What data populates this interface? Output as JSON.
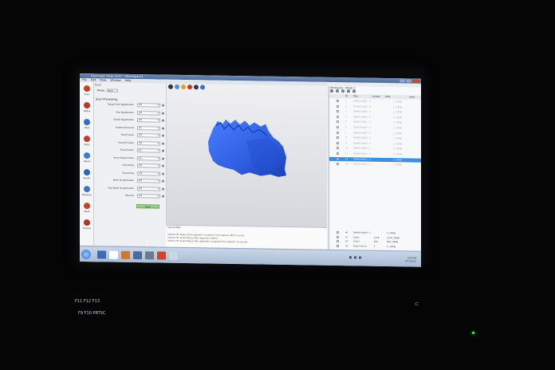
{
  "window": {
    "title": "Geomagic Wrap 2013 - [Workspace]"
  },
  "menu": [
    "File",
    "Edit",
    "View",
    "Window",
    "Help"
  ],
  "toolbar_left": [
    {
      "label": "Scan",
      "icon": "scan-icon",
      "color": "#c8401f"
    },
    {
      "label": "Tables",
      "icon": "tables-icon",
      "color": "#b33a2a"
    },
    {
      "label": "Tools",
      "icon": "tools-icon",
      "color": "#2e6ec8"
    },
    {
      "label": "Align",
      "icon": "align-icon",
      "color": "#c23c2c"
    },
    {
      "label": "Object",
      "icon": "object-icon",
      "color": "#3b7bd3"
    },
    {
      "label": "Repair",
      "icon": "repair-icon",
      "color": "#2c64ba"
    },
    {
      "label": "Measure",
      "icon": "measure-icon",
      "color": "#4073c7"
    },
    {
      "label": "Mesh",
      "icon": "mesh-icon",
      "color": "#c5432b"
    },
    {
      "label": "Feature",
      "icon": "feature-icon",
      "color": "#b13424"
    }
  ],
  "panel": {
    "title": "Scan",
    "mode_label": "Mode:",
    "mode_value": "Auto",
    "section": "Scan Processing",
    "rows": [
      {
        "label": "Rough Scan Registration",
        "value": "Off"
      },
      {
        "label": "Fine Registration",
        "value": "Off"
      },
      {
        "label": "Global Registration",
        "value": "Off"
      },
      {
        "label": "Outliers Removal",
        "value": "On"
      },
      {
        "label": "Trash Fusion",
        "value": "Off"
      },
      {
        "label": "Smooth Fusion",
        "value": "Off"
      },
      {
        "label": "Sharp Fusion",
        "value": "On"
      },
      {
        "label": "Small Objects Filter",
        "value": "On"
      },
      {
        "label": "Hole Filling",
        "value": "Off"
      },
      {
        "label": "Smoothing",
        "value": "Off"
      },
      {
        "label": "Mesh Simplification",
        "value": "Off"
      },
      {
        "label": "Fast Mesh Simplification",
        "value": "Off"
      },
      {
        "label": "Rename",
        "value": "Off"
      }
    ],
    "start_label": "Start"
  },
  "viewport": {
    "tools": [
      "#333333",
      "#4a90d9",
      "#e0a020",
      "#c0392b",
      "#2c3e50",
      "#3f6fd1"
    ],
    "mesh_color": "#2f5fe0"
  },
  "log": {
    "title": "Log window",
    "lines": [
      "3:08:56 PM: Sharp Fusion algorithm completed, time elapsed: 480.5 seconds",
      "3:09:21 PM: Small Objects Filter algorithm started",
      "3:09:51 PM: Small Objects Filter algorithm completed, time elapsed: 16 seconds"
    ]
  },
  "workspace": {
    "title": "Workspace · Model 1",
    "columns": [
      "ID",
      "Title",
      "Locked",
      "Total",
      "Used"
    ],
    "rows": [
      {
        "id": "1",
        "title": "SNAN0-00001 - 0",
        "total": "1 / 20MB",
        "selected": false
      },
      {
        "id": "2",
        "title": "SNAN0-00002 - 0",
        "total": "1 / 20MB",
        "selected": false
      },
      {
        "id": "3",
        "title": "SNAN0-00003 - 0",
        "total": "1 / 20MB",
        "selected": false
      },
      {
        "id": "4",
        "title": "SNAN0-00004 - 0",
        "total": "1 / 20MB",
        "selected": false
      },
      {
        "id": "5",
        "title": "SNAN0-00005 - 0",
        "total": "1 / 20MB",
        "selected": false
      },
      {
        "id": "6",
        "title": "SNAN0-00006 - 0",
        "total": "1 / 20MB",
        "selected": false
      },
      {
        "id": "7",
        "title": "SNAN0-00007 - 0",
        "total": "1 / 20MB",
        "selected": false
      },
      {
        "id": "8",
        "title": "SNAN0-00008 - 0",
        "total": "1 / 20MB",
        "selected": false
      },
      {
        "id": "9",
        "title": "SNAN0-00009 - 0",
        "total": "1 / 20MB",
        "selected": false
      },
      {
        "id": "10",
        "title": "SNAN0-00010 - 0",
        "total": "1 / 20MB",
        "selected": false
      },
      {
        "id": "11",
        "title": "SNAN0-00011 - 0",
        "total": "1 / 20MB",
        "selected": false
      },
      {
        "id": "12",
        "title": "SNAN0-00012 - 0",
        "total": "1 / 20MB",
        "selected": true
      },
      {
        "id": "13",
        "title": "SNAN0-00013 - 0",
        "total": "1 / 20MB",
        "selected": false
      }
    ],
    "bottom_rows": [
      {
        "id": "40",
        "title": "SNAN0-00040 - 2",
        "locked": "",
        "total": "1 / 20MB"
      },
      {
        "id": "41",
        "title": "Scan1",
        "locked": "1278",
        "total": "1278 / 30MB"
      },
      {
        "id": "42",
        "title": "Scan2",
        "locked": "839",
        "total": "839 / 30MB"
      },
      {
        "id": "43",
        "title": "Model Scan 0",
        "locked": "1",
        "total": "1 / 20MB"
      }
    ]
  },
  "status": {
    "text": "Scan 1 · 304 / 1006 MB · Total memory in use: 1,024 MB · Ready"
  },
  "clock": {
    "time": "3:09 PM",
    "date": "7/31/2013"
  },
  "taskbar_apps": [
    "#3b6bb0",
    "#ffffff",
    "#d0772f",
    "#4a6a9c",
    "#6a7a8e",
    "#c94431",
    "#c8d6e6"
  ],
  "keyboard": {
    "row1": "F11 F12 F13",
    "row2": "F9 F10 PRTSC"
  }
}
